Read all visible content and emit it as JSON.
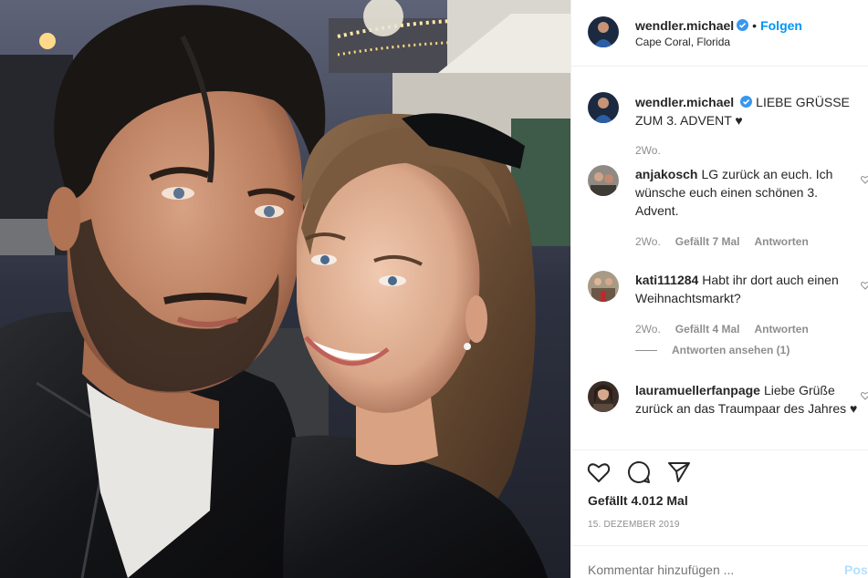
{
  "post": {
    "username": "wendler.michael",
    "follow_separator": "•",
    "follow_label": "Folgen",
    "location": "Cape Coral, Florida",
    "caption": {
      "username": "wendler.michael",
      "text": "LIEBE GRÜSSE ZUM 3. ADVENT ♥",
      "time": "2Wo."
    },
    "comments": [
      {
        "username": "anjakosch",
        "text": "LG zurück an euch. Ich wünsche euch einen schönen 3. Advent.",
        "time": "2Wo.",
        "likes": "Gefällt 7 Mal",
        "reply": "Antworten"
      },
      {
        "username": "kati111284",
        "text": "Habt ihr dort auch einen Weihnachtsmarkt?",
        "time": "2Wo.",
        "likes": "Gefällt 4 Mal",
        "reply": "Antworten",
        "view_replies": "Antworten ansehen (1)"
      },
      {
        "username": "lauramuellerfanpage",
        "text": "Liebe Grüße zurück an das Traumpaar des Jahres ♥"
      }
    ],
    "likes_count": "Gefällt 4.012 Mal",
    "date": "15. DEZEMBER 2019",
    "comment_placeholder": "Kommentar hinzufügen ...",
    "post_button": "Posten"
  },
  "icons": {
    "verified": "verified-badge-icon",
    "like": "heart-outline-icon",
    "comment": "speech-bubble-icon",
    "share": "paper-plane-icon",
    "comment_like": "small-heart-icon"
  },
  "colors": {
    "link_blue": "#0095f6",
    "muted": "#8e8e8e",
    "text": "#262626",
    "divider": "#efefef"
  }
}
